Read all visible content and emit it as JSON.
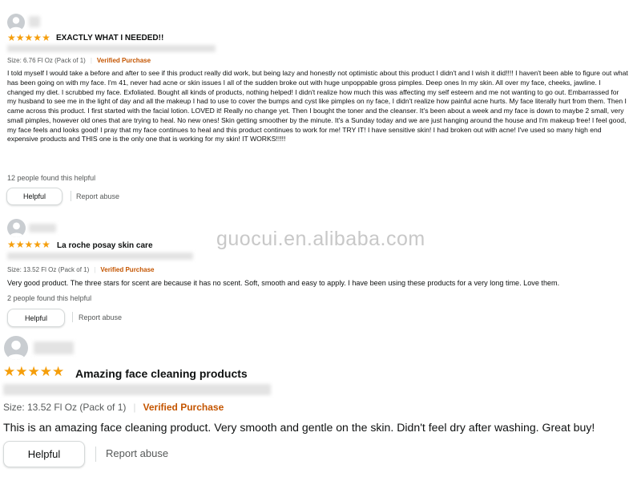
{
  "watermark": "guocui.en.alibaba.com",
  "icons": {
    "avatar": "user-silhouette-icon",
    "star": "star-icon"
  },
  "colors": {
    "star": "#f59e0b",
    "verified": "#c45500",
    "muted": "#565959",
    "divider": "#d5d9d9"
  },
  "reviews": [
    {
      "rating": 5,
      "title": "EXACTLY WHAT I NEEDED!!",
      "size": "Size: 6.76 Fl Oz (Pack of 1)",
      "verified": "Verified Purchase",
      "body": "I told myself I would take a before and after to see if this product really did work, but being lazy and honestly not optimistic about this product I didn't and I wish it did!!!! I haven't been able to figure out what has been going on with my face. I'm 41, never had acne or skin issues I all of the sudden broke out with huge unpoppable gross pimples. Deep ones In my skin. All over my face, cheeks, jawline. I changed my diet. I scrubbed my face. Exfoliated. Bought all kinds of products, nothing helped! I didn't realize how much this was affecting my self esteem and me not wanting to go out. Embarrassed for my husband to see me in the light of day and all the makeup I had to use to cover the bumps and cyst like pimples on ny face, I didn't realize how painful acne hurts. My face literally hurt from them. Then I came across this product. I first started with the facial lotion. LOVED it! Really no change yet. Then I bought the toner and the cleanser. It's been about a week and my face is down to maybe 2 small, very small pimples, however old ones that are trying to heal. No new ones! Skin getting smoother by the minute. It's a Sunday today and we are just hanging around the house and I'm makeup free! I feel good, my face feels and looks good! I pray that my face continues to heal and this product continues to work for me! TRY IT! I have sensitive skin! I had broken out with acne! I've used so many high end expensive products and THIS one is the only one that is working for my skin! IT WORKS!!!!!",
      "found": "12 people found this helpful",
      "helpful": "Helpful",
      "report": "Report abuse"
    },
    {
      "rating": 5,
      "title": "La roche posay skin care",
      "size": "Size: 13.52 Fl Oz (Pack of 1)",
      "verified": "Verified Purchase",
      "body": "Very good product. The three stars for scent are because it has no scent. Soft, smooth and easy to apply. I have been using these products for a very long time. Love them.",
      "found": "2 people found this helpful",
      "helpful": "Helpful",
      "report": "Report abuse"
    },
    {
      "rating": 5,
      "title": "Amazing face cleaning products",
      "size": "Size: 13.52 Fl Oz (Pack of 1)",
      "verified": "Verified Purchase",
      "body": "This is an amazing face cleaning product. Very smooth and gentle on the skin. Didn't feel dry after washing. Great buy!",
      "helpful": "Helpful",
      "report": "Report abuse"
    }
  ]
}
